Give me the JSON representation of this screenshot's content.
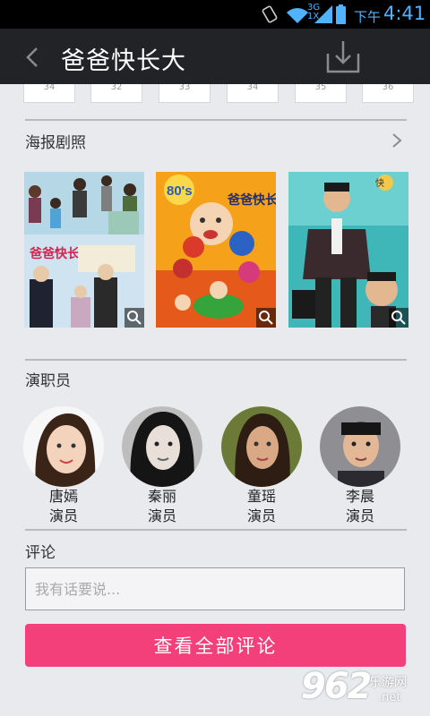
{
  "status_bar": {
    "network": "3G",
    "network2": "1X",
    "ampm": "下午",
    "time": "4:41"
  },
  "header": {
    "title": "爸爸快长大"
  },
  "episodes": [
    "34",
    "32",
    "33",
    "34",
    "35",
    "36"
  ],
  "posters": {
    "section_title": "海报剧照",
    "items": [
      {
        "title": "爸爸快长大"
      },
      {
        "title": "爸爸快长大",
        "badge": "80's"
      },
      {
        "title": "快"
      }
    ]
  },
  "cast": {
    "section_title": "演职员",
    "members": [
      {
        "name": "唐嫣",
        "role": "演员"
      },
      {
        "name": "秦丽",
        "role": "演员"
      },
      {
        "name": "童瑶",
        "role": "演员"
      },
      {
        "name": "李晨",
        "role": "演员"
      }
    ]
  },
  "comments": {
    "section_title": "评论",
    "placeholder": "我有话要说...",
    "view_all_label": "查看全部评论"
  },
  "watermark": {
    "number": "962",
    "site": "乐游网",
    "domain": ".net"
  }
}
